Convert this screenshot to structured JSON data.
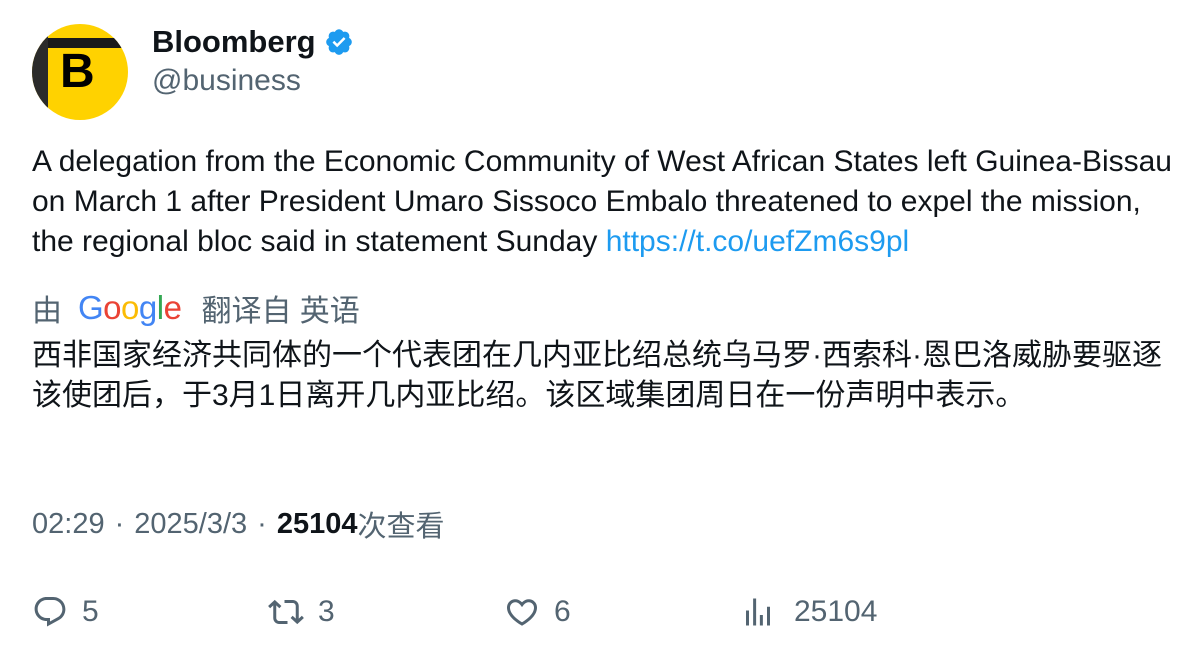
{
  "author": {
    "display_name": "Bloomberg",
    "handle": "@business",
    "avatar_letter": "B",
    "verified": true
  },
  "tweet": {
    "text": "A delegation from the Economic Community of West African States left Guinea-Bissau on March 1 after President Umaro Sissoco Embalo threatened to expel the mission, the regional bloc said in statement Sunday ",
    "link": "https://t.co/uefZm6s9pl"
  },
  "translation": {
    "by_label": "由",
    "provider": "Google",
    "label": "翻译自 英语",
    "text": "西非国家经济共同体的一个代表团在几内亚比绍总统乌马罗·西索科·恩巴洛威胁要驱逐该使团后，于3月1日离开几内亚比绍。该区域集团周日在一份声明中表示。"
  },
  "meta": {
    "time": "02:29",
    "separator": "·",
    "date": "2025/3/3",
    "views": "25104",
    "views_label": "次查看"
  },
  "actions": {
    "replies": "5",
    "retweets": "3",
    "likes": "6",
    "views": "25104"
  },
  "colors": {
    "text": "#0f1419",
    "secondary": "#536471",
    "link": "#1d9bf0",
    "verified": "#1d9bf0",
    "avatar_bg": "#ffd200"
  },
  "icons": {
    "verified": "verified-badge-icon",
    "reply": "reply-icon",
    "retweet": "retweet-icon",
    "like": "heart-icon",
    "views": "views-chart-icon"
  }
}
